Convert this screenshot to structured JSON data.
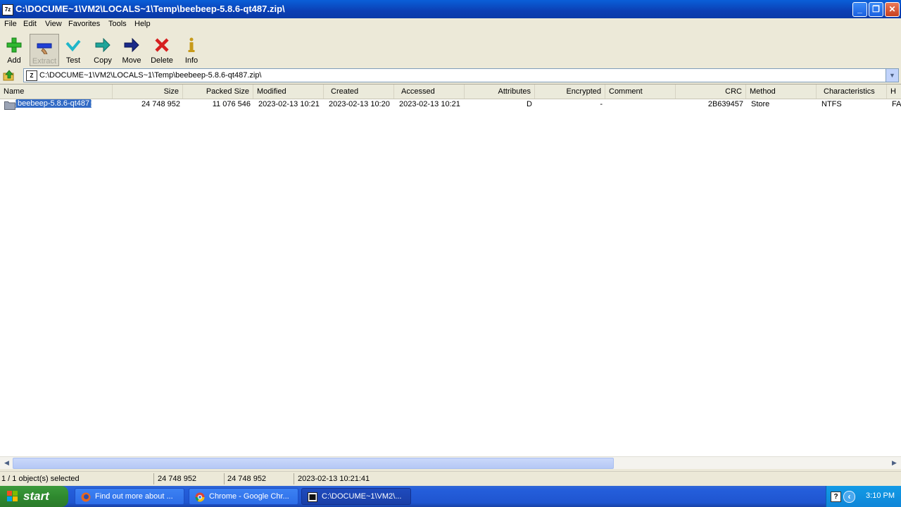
{
  "window": {
    "app_icon_text": "7z",
    "title": "C:\\DOCUME~1\\VM2\\LOCALS~1\\Temp\\beebeep-5.8.6-qt487.zip\\",
    "controls": {
      "minimize": "_",
      "maximize": "❐",
      "close": "✕"
    }
  },
  "menu": {
    "items": [
      "File",
      "Edit",
      "View",
      "Favorites",
      "Tools",
      "Help"
    ]
  },
  "toolbar": {
    "buttons": [
      {
        "label": "Add",
        "icon": "plus-icon"
      },
      {
        "label": "Extract",
        "icon": "minus-icon"
      },
      {
        "label": "Test",
        "icon": "check-icon"
      },
      {
        "label": "Copy",
        "icon": "arrow-right-icon"
      },
      {
        "label": "Move",
        "icon": "arrow-right-dark-icon"
      },
      {
        "label": "Delete",
        "icon": "x-icon"
      },
      {
        "label": "Info",
        "icon": "info-icon"
      }
    ]
  },
  "address": {
    "path": "C:\\DOCUME~1\\VM2\\LOCALS~1\\Temp\\beebeep-5.8.6-qt487.zip\\",
    "zip_icon_text": "Z",
    "dropdown_glyph": "▼"
  },
  "list": {
    "columns": [
      "Name",
      "Size",
      "Packed Size",
      "Modified",
      "Created",
      "Accessed",
      "Attributes",
      "Encrypted",
      "Comment",
      "CRC",
      "Method",
      "Characteristics",
      "H"
    ],
    "rows": [
      {
        "name": "beebeep-5.8.6-qt487",
        "size": "24 748 952",
        "packed_size": "11 076 546",
        "modified": "2023-02-13 10:21",
        "created": "2023-02-13 10:20",
        "accessed": "2023-02-13 10:21",
        "attributes": "D",
        "encrypted": "-",
        "comment": "",
        "crc": "2B639457",
        "method": "Store",
        "characteristics": "NTFS",
        "h": "FA"
      }
    ]
  },
  "scrollbar": {
    "left_arrow": "◀",
    "right_arrow": "▶"
  },
  "status": {
    "selection": "1 / 1 object(s) selected",
    "size": "24 748 952",
    "packed": "24 748 952",
    "modified": "2023-02-13 10:21:41"
  },
  "taskbar": {
    "start_label": "start",
    "tasks": [
      {
        "label": "Find out more about ...",
        "icon": "firefox-icon"
      },
      {
        "label": "Chrome - Google Chr...",
        "icon": "chrome-icon"
      },
      {
        "label": "C:\\DOCUME~1\\VM2\\...",
        "icon": "sevenzip-icon",
        "active": true
      }
    ],
    "tray_help": "?",
    "tray_arrow": "‹",
    "clock": "3:10 PM"
  },
  "colors": {
    "title_bar": "#0b3fb4",
    "selection": "#316ac5",
    "taskbar": "#245edb",
    "start_button": "#2f8a2f"
  }
}
